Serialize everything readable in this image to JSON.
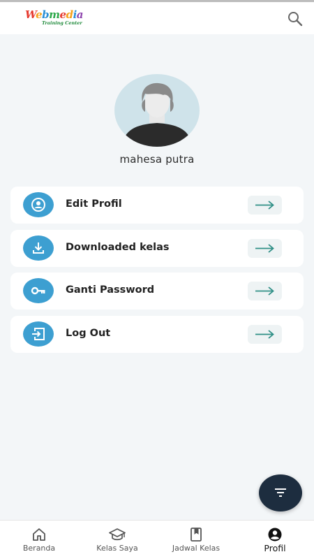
{
  "app": {
    "logo_text": "Webmedia",
    "logo_subtitle": "Training Center",
    "logo_colors": [
      "#e63a2f",
      "#f6a21a",
      "#2a8fd6",
      "#2da84a",
      "#8e44ad"
    ]
  },
  "header": {
    "search_icon": "search-icon"
  },
  "profile": {
    "name": "mahesa putra"
  },
  "menu": [
    {
      "label": "Edit Profil",
      "icon": "account-circle-icon"
    },
    {
      "label": "Downloaded kelas",
      "icon": "download-icon"
    },
    {
      "label": "Ganti Password",
      "icon": "key-icon"
    },
    {
      "label": "Log Out",
      "icon": "logout-icon"
    }
  ],
  "fab": {
    "icon": "filter-icon"
  },
  "bottom_nav": [
    {
      "label": "Beranda",
      "icon": "home-icon",
      "active": false
    },
    {
      "label": "Kelas Saya",
      "icon": "graduation-cap-icon",
      "active": false
    },
    {
      "label": "Jadwal Kelas",
      "icon": "book-icon",
      "active": false
    },
    {
      "label": "Profil",
      "icon": "account-circle-icon",
      "active": true
    }
  ],
  "colors": {
    "accent_blue": "#3d9fd1",
    "arrow_teal": "#2f8f86",
    "fab_navy": "#1d2d3f",
    "background": "#f3f6f8"
  }
}
